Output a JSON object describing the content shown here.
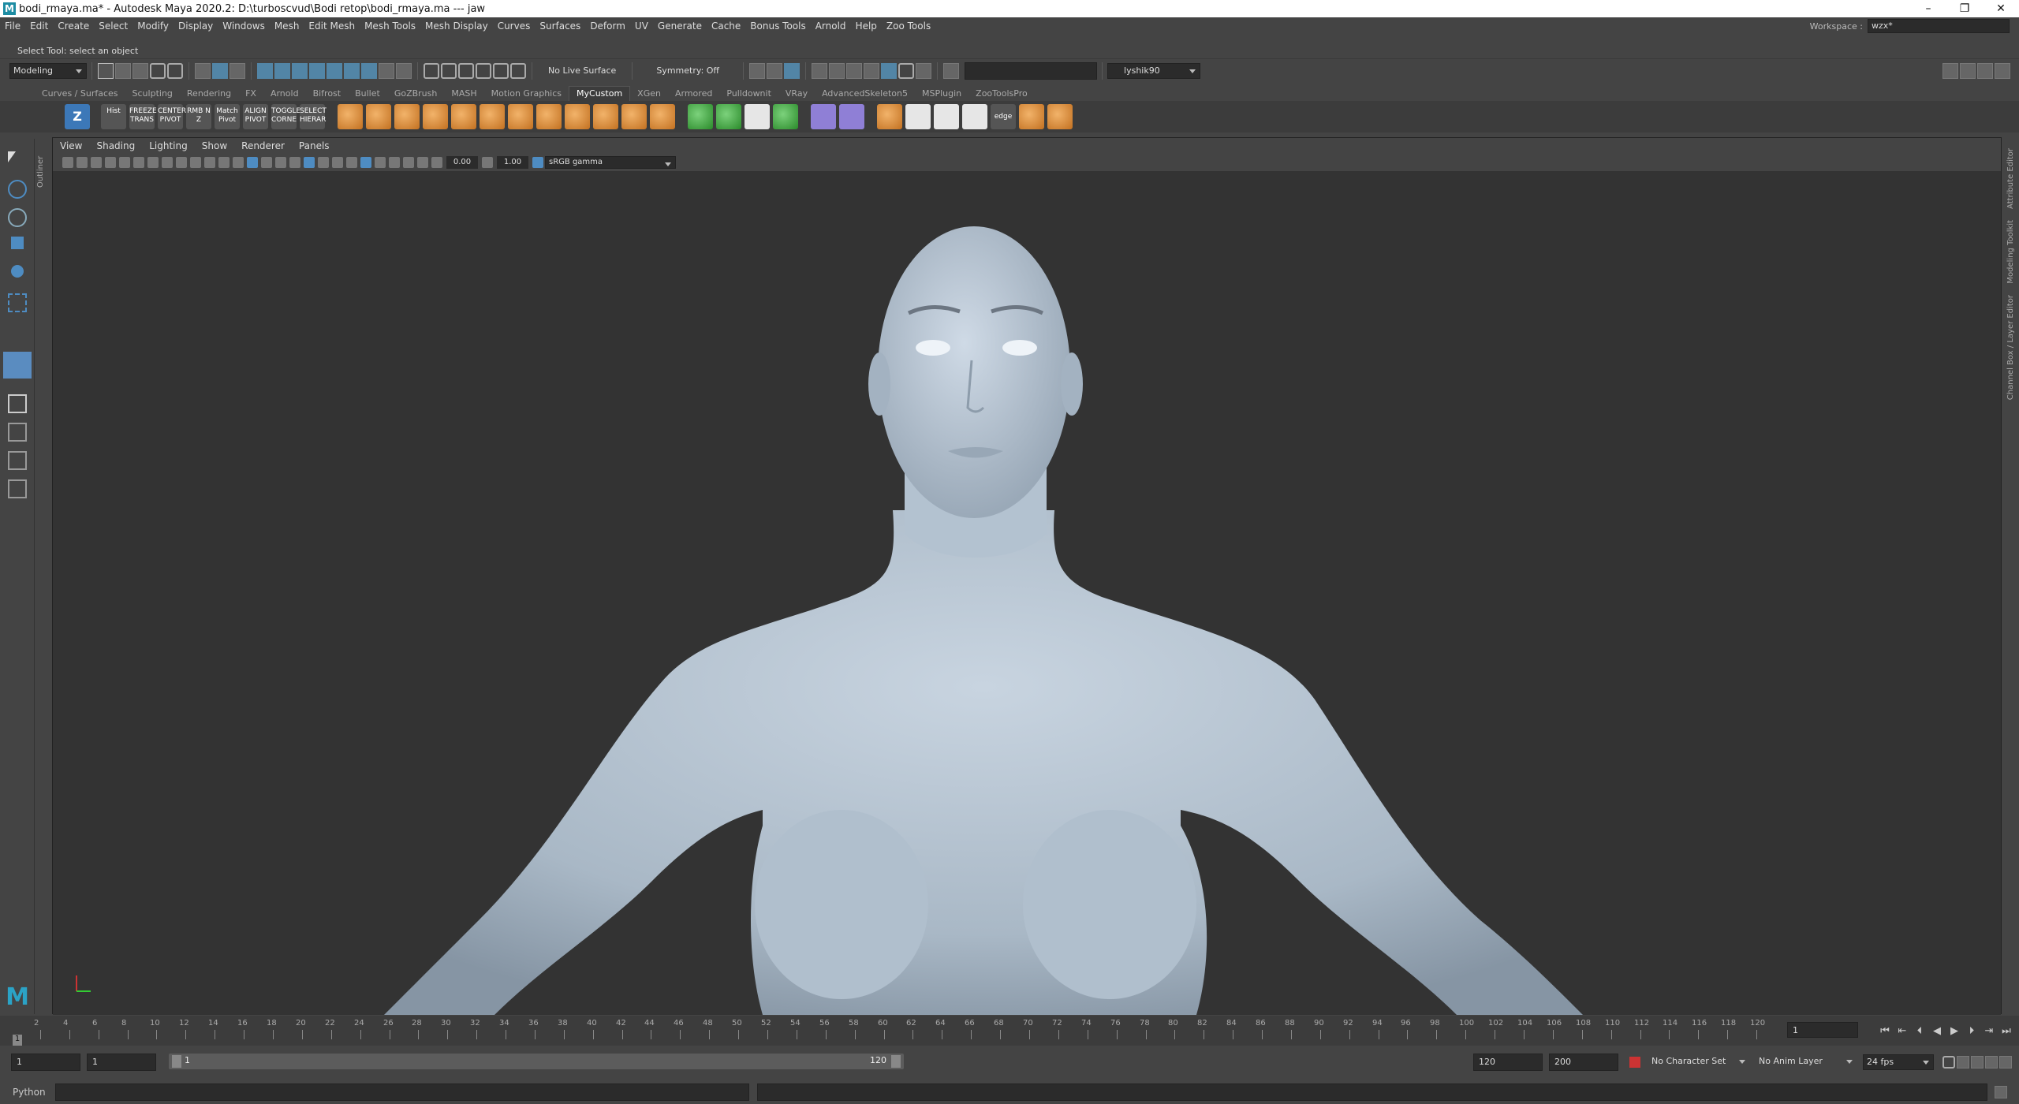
{
  "titlebar": {
    "app_icon": "M",
    "title": "bodi_rmaya.ma* - Autodesk Maya 2020.2: D:\\turboscvud\\Bodi retop\\bodi_rmaya.ma  ---  jaw",
    "minimize": "–",
    "restore": "❐",
    "close": "✕"
  },
  "menubar": {
    "items": [
      "File",
      "Edit",
      "Create",
      "Select",
      "Modify",
      "Display",
      "Windows",
      "Mesh",
      "Edit Mesh",
      "Mesh Tools",
      "Mesh Display",
      "Curves",
      "Surfaces",
      "Deform",
      "UV",
      "Generate",
      "Cache",
      "Bonus Tools",
      "Arnold",
      "Help",
      "Zoo Tools"
    ],
    "workspace_label": "Workspace :",
    "workspace_value": "wzx*"
  },
  "toolbar": {
    "mode": "Modeling",
    "live_surface": "No Live Surface",
    "symmetry": "Symmetry: Off",
    "user": "lyshik90"
  },
  "helpline": {
    "text": "Select Tool: select an object"
  },
  "shelf": {
    "tabs": [
      "Curves / Surfaces",
      "Sculpting",
      "Rendering",
      "FX",
      "Arnold",
      "Bifrost",
      "Bullet",
      "GoZBrush",
      "MASH",
      "Motion Graphics",
      "MyCustom",
      "XGen",
      "Armored",
      "Pulldownit",
      "VRay",
      "AdvancedSkeleton5",
      "MSPlugin",
      "ZooToolsPro"
    ],
    "active_tab": "MyCustom",
    "buttons": [
      {
        "label": "Hist",
        "color": "txt"
      },
      {
        "label": "FREEZE TRANS",
        "color": "txt"
      },
      {
        "label": "CENTER PIVOT",
        "color": "txt"
      },
      {
        "label": "RMB N Z",
        "color": "txt"
      },
      {
        "label": "Match Pivot",
        "color": "txt"
      },
      {
        "label": "ALIGN PIVOT",
        "color": "txt"
      },
      {
        "label": "TOGGLE CORNE",
        "color": "txt"
      },
      {
        "label": "SELECT HIERAR",
        "color": "txt"
      }
    ],
    "edge_label": "edge"
  },
  "left_panel": {
    "outliner": "Outliner"
  },
  "viewport": {
    "menus": [
      "View",
      "Shading",
      "Lighting",
      "Show",
      "Renderer",
      "Panels"
    ],
    "exposure": "0.00",
    "gamma": "1.00",
    "colorspace": "sRGB gamma"
  },
  "right_panel": {
    "tabs": [
      "Attribute Editor",
      "Modeling Toolkit",
      "Channel Box / Layer Editor"
    ]
  },
  "timeline": {
    "ticks": [
      "2",
      "4",
      "6",
      "8",
      "10",
      "12",
      "14",
      "16",
      "18",
      "20",
      "22",
      "24",
      "26",
      "28",
      "30",
      "32",
      "34",
      "36",
      "38",
      "40",
      "42",
      "44",
      "46",
      "48",
      "50",
      "52",
      "54",
      "56",
      "58",
      "60",
      "62",
      "64",
      "66",
      "68",
      "70",
      "72",
      "74",
      "76",
      "78",
      "80",
      "82",
      "84",
      "86",
      "88",
      "90",
      "92",
      "94",
      "96",
      "98",
      "100",
      "102",
      "104",
      "106",
      "108",
      "110",
      "112",
      "114",
      "116",
      "118",
      "120"
    ],
    "current_frame": "1",
    "frame_field": "1"
  },
  "range": {
    "start": "1",
    "anim_start": "1",
    "range_start": "1",
    "range_end": "120",
    "anim_end": "120",
    "end": "200",
    "character_set": "No Character Set",
    "anim_layer": "No Anim Layer",
    "fps": "24 fps"
  },
  "cmdline": {
    "lang": "Python"
  },
  "colors": {
    "accent": "#5285a6",
    "model": "#b4c3d2",
    "background": "#3a3a3a"
  }
}
